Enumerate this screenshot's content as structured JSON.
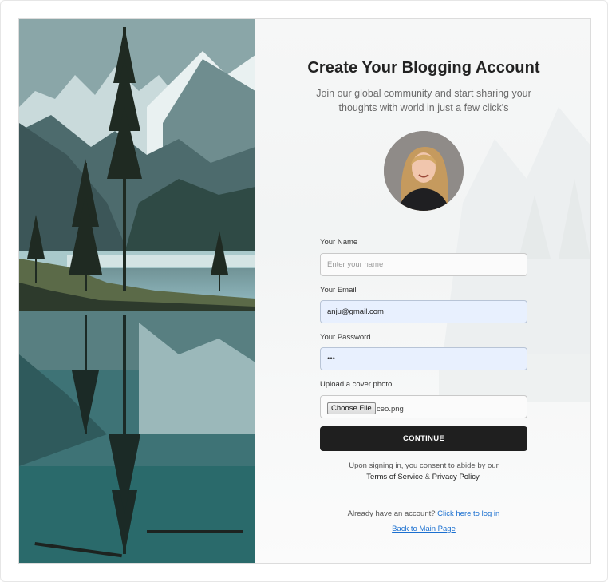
{
  "form": {
    "title": "Create Your Blogging Account",
    "subtitle": "Join our global community and start sharing your thoughts with world in just a few click's",
    "name_label": "Your Name",
    "name_placeholder": "Enter your name",
    "name_value": "",
    "email_label": "Your Email",
    "email_value": "anju@gmail.com",
    "password_label": "Your Password",
    "password_value": "abc",
    "cover_label": "Upload a cover photo",
    "choose_file_label": "Choose File",
    "file_name": "ceo.png",
    "continue_label": "CONTINUE"
  },
  "terms": {
    "prefix": "Upon signing in, you consent to abide by our",
    "tos": "Terms of Service",
    "amp": "&",
    "privacy": "Privacy Policy",
    "suffix": "."
  },
  "footer": {
    "have_account": "Already have an account?",
    "login_link": "Click here to log in",
    "back_link": "Back to Main Page"
  },
  "colors": {
    "button": "#1f1f1f",
    "link": "#1a6fd0",
    "autofill": "#e8f0fe"
  },
  "icons": {
    "avatar": "profile-photo"
  }
}
